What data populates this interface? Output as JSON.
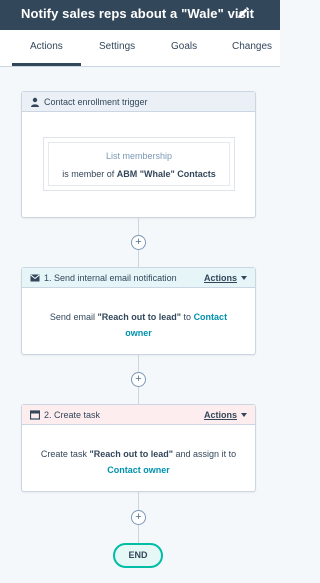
{
  "header": {
    "title": "Notify sales reps about a \"Wale\" visit",
    "edit_icon": "pencil-icon"
  },
  "tabs": [
    {
      "label": "Actions",
      "active": true
    },
    {
      "label": "Settings",
      "active": false
    },
    {
      "label": "Goals",
      "active": false
    },
    {
      "label": "Changes",
      "active": false
    }
  ],
  "trigger": {
    "title": "Contact enrollment trigger",
    "icon": "person-icon",
    "filter_type": "List membership",
    "condition_prefix": "is member of",
    "list_name": "ABM \"Whale\" Contacts"
  },
  "step1": {
    "title": "1. Send internal email notification",
    "icon": "envelope-icon",
    "actions_label": "Actions",
    "text_pre": "Send email",
    "email_name": "\"Reach out to lead\"",
    "text_mid": "to",
    "recipient": "Contact owner"
  },
  "step2": {
    "title": "2. Create task",
    "icon": "task-icon",
    "actions_label": "Actions",
    "text_pre": "Create task",
    "task_name": "\"Reach out to lead\"",
    "text_mid": "and assign it to",
    "assignee": "Contact owner"
  },
  "add_action_symbol": "+",
  "end_label": "END",
  "colors": {
    "header_bg": "#33475b",
    "trigger_head": "#eaf0f6",
    "email_head": "#e5f5f8",
    "task_head": "#fdedee",
    "link": "#0091ae",
    "end_border": "#00bda5"
  }
}
